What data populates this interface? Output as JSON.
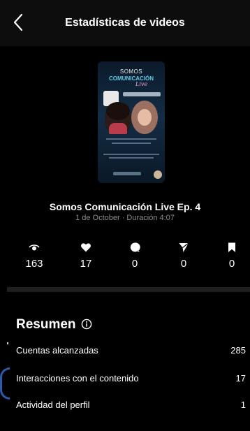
{
  "header": {
    "title": "Estadísticas de videos",
    "back_icon": "chevron-left-icon"
  },
  "thumbnail": {
    "line1": "SOMOS",
    "line2": "COMUNICACIÓN",
    "line3": "Live"
  },
  "video": {
    "title": "Somos Comunicación Live Ep. 4",
    "meta": "1 de October · Duración 4:07"
  },
  "stats": [
    {
      "icon": "eye-icon",
      "value": "163"
    },
    {
      "icon": "heart-icon",
      "value": "17"
    },
    {
      "icon": "comment-icon",
      "value": "0"
    },
    {
      "icon": "send-icon",
      "value": "0"
    },
    {
      "icon": "bookmark-icon",
      "value": "0"
    }
  ],
  "summary": {
    "title": "Resumen",
    "info_icon": "info-icon",
    "rows": [
      {
        "label": "Cuentas alcanzadas",
        "value": "285"
      },
      {
        "label": "Interacciones con el contenido",
        "value": "17"
      },
      {
        "label": "Actividad del perfil",
        "value": "1"
      }
    ]
  },
  "colors": {
    "background": "#000000",
    "header": "#0d0d0d",
    "text": "#ffffff",
    "muted": "#8e8e8e",
    "divider": "#1e1e1e"
  }
}
